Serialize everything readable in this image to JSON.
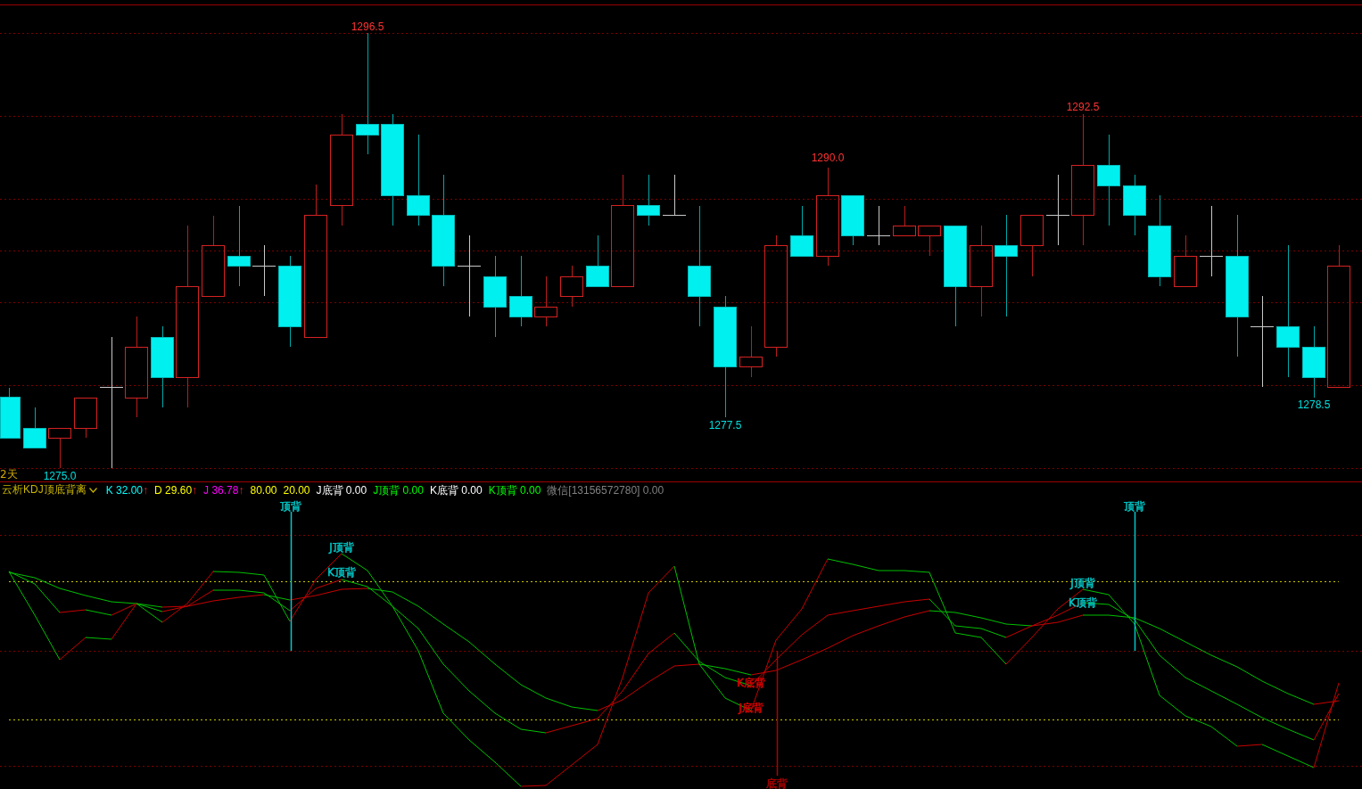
{
  "price_panel": {
    "period_label": "2天",
    "extreme_labels": [
      {
        "text": "1296.5",
        "kind": "high"
      },
      {
        "text": "1292.5",
        "kind": "high"
      },
      {
        "text": "1290.0",
        "kind": "high"
      },
      {
        "text": "1278.5",
        "kind": "low"
      },
      {
        "text": "1277.5",
        "kind": "low"
      },
      {
        "text": "1275.0",
        "kind": "low"
      }
    ]
  },
  "indicator_panel": {
    "name": "云析KDJ顶底背离",
    "readings": [
      {
        "label": "K",
        "value": "32.00",
        "arrow": "↑",
        "color": "#00ffff"
      },
      {
        "label": "D",
        "value": "29.60",
        "arrow": "↑",
        "color": "#ffff00"
      },
      {
        "label": "J",
        "value": "36.78",
        "arrow": "↑",
        "color": "#ff00ff"
      },
      {
        "value": "80.00",
        "color": "#ffff00"
      },
      {
        "value": "20.00",
        "color": "#ffff00"
      },
      {
        "label": "J底背",
        "value": "0.00",
        "color": "#ffffff"
      },
      {
        "label": "J顶背",
        "value": "0.00",
        "color": "#00ff00"
      },
      {
        "label": "K底背",
        "value": "0.00",
        "color": "#ffffff"
      },
      {
        "label": "K顶背",
        "value": "0.00",
        "color": "#00ff00"
      },
      {
        "label": "微信[13156572780]",
        "value": "0.00",
        "color": "#808080"
      }
    ],
    "signals": [
      {
        "text": "顶背",
        "kind": "marker",
        "color": "#00c8c8"
      },
      {
        "text": "J顶背",
        "kind": "label",
        "color": "#00c8c8"
      },
      {
        "text": "K顶背",
        "kind": "label",
        "color": "#00c8c8"
      },
      {
        "text": "K底背",
        "kind": "label",
        "color": "#e00000"
      },
      {
        "text": "J底背",
        "kind": "label",
        "color": "#e00000"
      },
      {
        "text": "底背",
        "kind": "marker",
        "color": "#b00000"
      },
      {
        "text": "J顶背",
        "kind": "label",
        "color": "#00c8c8"
      },
      {
        "text": "K顶背",
        "kind": "label",
        "color": "#00c8c8"
      },
      {
        "text": "顶背",
        "kind": "marker",
        "color": "#00c8c8"
      }
    ]
  }
}
